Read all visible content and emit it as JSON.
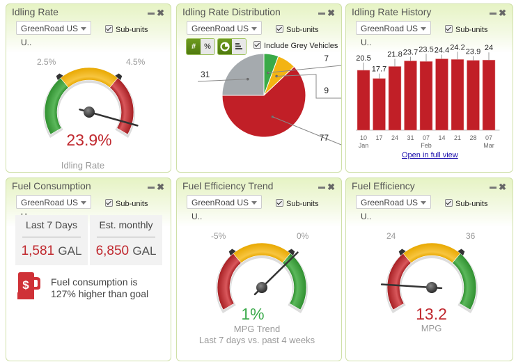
{
  "common": {
    "unit_select_value": "GreenRoad US U..",
    "subunits_label": "Sub-units",
    "subunits_checked": true
  },
  "colors": {
    "green": "#3a9a3a",
    "yellow": "#f0b420",
    "red": "#c0282e",
    "grey": "#a5aaae",
    "header_green": "#e6f3c4",
    "toggle_green": "#5a8a14",
    "link": "#1a0dab"
  },
  "idling_rate": {
    "title": "Idling Rate",
    "value": "23.9%",
    "value_color": "#c0282e",
    "label": "Idling Rate",
    "tick_low": "2.5%",
    "tick_high": "4.5%",
    "zones": [
      "green",
      "yellow",
      "red"
    ],
    "needle_fraction": 0.94
  },
  "idling_distribution": {
    "title": "Idling Rate Distribution",
    "toggle_count": "#",
    "toggle_percent": "%",
    "view_pie": "pie-chart-icon",
    "view_bar": "bar-chart-icon",
    "include_grey_label": "Include Grey Vehicles",
    "include_grey_checked": true
  },
  "idling_history": {
    "title": "Idling Rate History",
    "open_full_view": "Open in full view"
  },
  "fuel_consumption": {
    "title": "Fuel Consumption",
    "last7_label": "Last 7 Days",
    "last7_value": "1,581",
    "monthly_label": "Est. monthly",
    "monthly_value": "6,850",
    "unit": "GAL",
    "message": "Fuel consumption is 127% higher than goal",
    "icon": "fuel-pump-dollar-icon"
  },
  "fuel_efficiency_trend": {
    "title": "Fuel Efficiency Trend",
    "value": "1%",
    "value_color": "#3aaa4a",
    "label": "MPG Trend",
    "sublabel": "Last 7 days vs. past 4 weeks",
    "tick_low": "-5%",
    "tick_high": "0%",
    "zones": [
      "red",
      "yellow",
      "green"
    ],
    "needle_fraction": 0.69
  },
  "fuel_efficiency": {
    "title": "Fuel Efficiency",
    "value": "13.2",
    "value_color": "#c0282e",
    "label": "MPG",
    "tick_low": "24",
    "tick_high": "36",
    "zones": [
      "red",
      "yellow",
      "green"
    ],
    "needle_fraction": 0.14
  },
  "chart_data": [
    {
      "type": "pie",
      "title": "Idling Rate Distribution",
      "categories": [
        "Green",
        "Yellow",
        "Red",
        "Grey"
      ],
      "values": [
        7,
        9,
        77,
        31
      ],
      "colors": [
        "#3aaa48",
        "#f3b413",
        "#c11f27",
        "#a5aaae"
      ]
    },
    {
      "type": "bar",
      "title": "Idling Rate History",
      "categories": [
        "10 Jan",
        "17",
        "24",
        "31",
        "07 Feb",
        "14",
        "21",
        "28",
        "07 Mar"
      ],
      "tick_labels": [
        [
          "10",
          "Jan"
        ],
        [
          "17",
          ""
        ],
        [
          "24",
          ""
        ],
        [
          "31",
          ""
        ],
        [
          "07",
          "Feb"
        ],
        [
          "14",
          ""
        ],
        [
          "21",
          ""
        ],
        [
          "28",
          ""
        ],
        [
          "07",
          "Mar"
        ]
      ],
      "values": [
        20.5,
        17.7,
        21.8,
        23.7,
        23.5,
        24.4,
        24.2,
        23.9,
        24
      ],
      "value_labels": [
        "20.5",
        "17.7",
        "21.8",
        "23.7",
        "23.5",
        "24.4",
        "24.2",
        "23.9",
        "24"
      ],
      "color": "#c11f27",
      "ylim": [
        0,
        25
      ],
      "xlabel": "",
      "ylabel": ""
    }
  ]
}
